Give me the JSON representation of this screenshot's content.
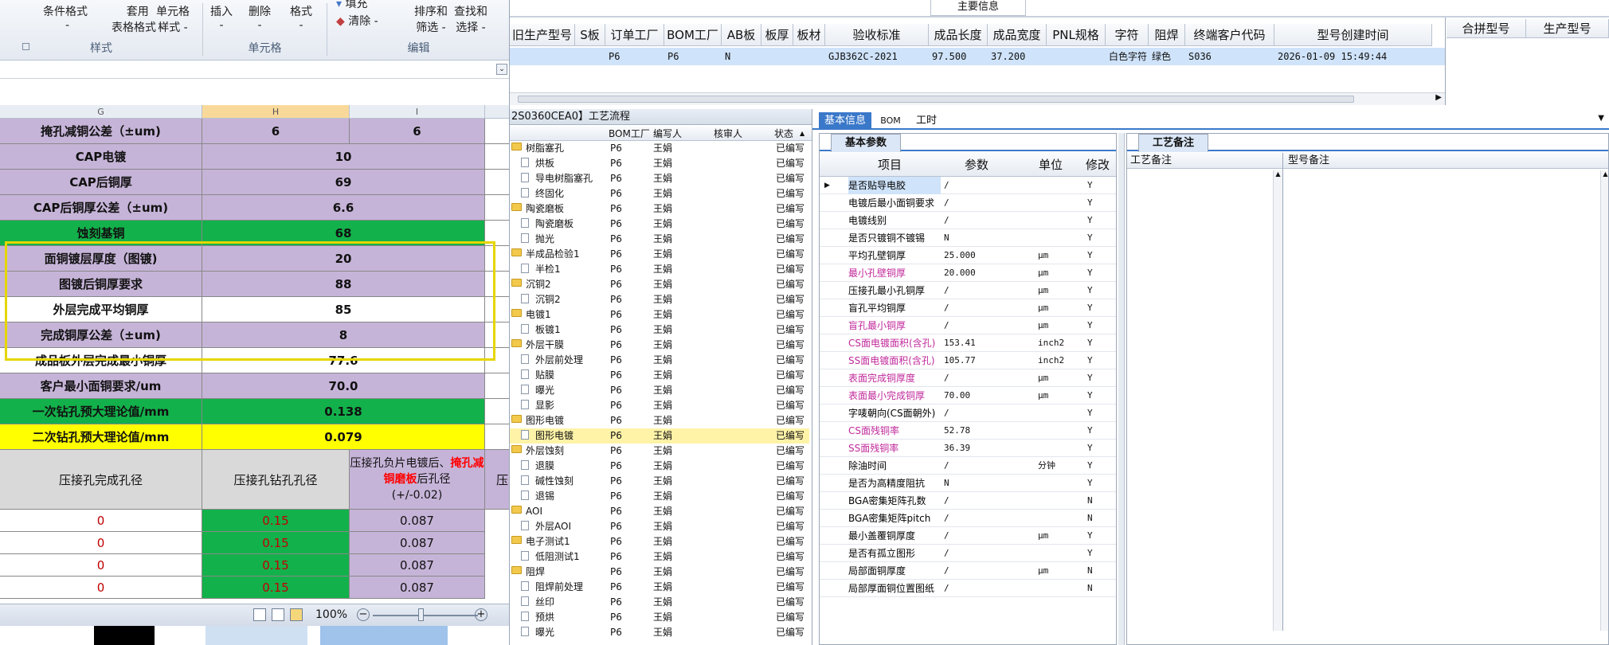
{
  "ribbon": {
    "buttons": [
      {
        "label": "条件格式",
        "sub": "-"
      },
      {
        "label": "套用",
        "sub": "表格格式 -"
      },
      {
        "label": "单元格",
        "sub": "样式 -"
      },
      {
        "label": "插入",
        "sub": "-"
      },
      {
        "label": "删除",
        "sub": "-"
      },
      {
        "label": "格式",
        "sub": "-"
      },
      {
        "label": "填充",
        "sub": ""
      },
      {
        "label": "清除 -",
        "sub": ""
      },
      {
        "label": "排序和",
        "sub": "筛选 -"
      },
      {
        "label": "查找和",
        "sub": "选择 -"
      }
    ],
    "groups": [
      "样式",
      "单元格",
      "编辑"
    ]
  },
  "sheet": {
    "columns": [
      "G",
      "H",
      "I"
    ],
    "rows": [
      {
        "label": "掩孔减铜公差（±um)",
        "h": "6",
        "i": "6",
        "fill": "pur"
      },
      {
        "label": "CAP电镀",
        "h": "10",
        "fill": "pur"
      },
      {
        "label": "CAP后铜厚",
        "h": "69",
        "fill": "pur"
      },
      {
        "label": "CAP后铜厚公差（±um)",
        "h": "6.6",
        "fill": "pur"
      },
      {
        "label": "蚀刻基铜",
        "h": "68",
        "fill": "grn"
      },
      {
        "label": "面铜镀层厚度（图镀)",
        "h": "20",
        "fill": "pur"
      },
      {
        "label": "图镀后铜厚要求",
        "h": "88",
        "fill": "pur"
      },
      {
        "label": "外层完成平均铜厚",
        "h": "85",
        "fill": "wht"
      },
      {
        "label": "完成铜厚公差（±um)",
        "h": "8",
        "fill": "pur"
      },
      {
        "label": "成品板外层完成最小铜厚",
        "h": "77.6",
        "fill": "wht"
      },
      {
        "label": "客户最小面铜要求/um",
        "h": "70.0",
        "fill": "pur"
      },
      {
        "label": "一次钻孔预大理论值/mm",
        "h": "0.138",
        "fill": "grn"
      },
      {
        "label": "二次钻孔预大理论值/mm",
        "h": "0.079",
        "fill": "yel"
      }
    ],
    "header2": {
      "g": "压接孔完成孔径",
      "h": "压接孔钻孔孔径",
      "i_pre": "压接孔负片电镀后、",
      "i_red": "掩孔减铜磨板",
      "i_post": "后孔径",
      "i_tol": "(+/-0.02)",
      "j": "压"
    },
    "lower_rows": [
      {
        "g": "0",
        "h": "0.15",
        "i": "0.087"
      },
      {
        "g": "0",
        "h": "0.15",
        "i": "0.087"
      },
      {
        "g": "0",
        "h": "0.15",
        "i": "0.087"
      },
      {
        "g": "0",
        "h": "0.15",
        "i": "0.087"
      }
    ],
    "zoom": "100%"
  },
  "topgrid": {
    "banner": "主要信息",
    "headers": [
      "旧生产型号",
      "S板",
      "订单工厂",
      "BOM工厂",
      "AB板",
      "板厚",
      "板材",
      "验收标准",
      "成品长度",
      "成品宽度",
      "PNL规格",
      "字符",
      "阻焊",
      "终端客户代码",
      "型号创建时间"
    ],
    "row": [
      "",
      "",
      "P6",
      "P6",
      "N",
      "",
      "",
      "GJB362C-2021",
      "97.500",
      "37.200",
      "",
      "白色字符",
      "绿色",
      "S036",
      "2026-01-09 15:49:44"
    ],
    "side_headers": [
      "合拼型号",
      "生产型号"
    ]
  },
  "process": {
    "title": "2S0360CEA0】工艺流程",
    "headers": [
      "BOM工厂",
      "编写人",
      "核审人",
      "状态"
    ],
    "rows": [
      {
        "name": "树脂塞孔",
        "folder": true,
        "f": "P6",
        "w": "王娟",
        "s": "已编写"
      },
      {
        "name": "烘板",
        "folder": false,
        "f": "P6",
        "w": "王娟",
        "s": "已编写"
      },
      {
        "name": "导电树脂塞孔",
        "folder": false,
        "f": "P6",
        "w": "王娟",
        "s": "已编写"
      },
      {
        "name": "终固化",
        "folder": false,
        "f": "P6",
        "w": "王娟",
        "s": "已编写"
      },
      {
        "name": "陶瓷磨板",
        "folder": true,
        "f": "P6",
        "w": "王娟",
        "s": "已编写"
      },
      {
        "name": "陶瓷磨板",
        "folder": false,
        "f": "P6",
        "w": "王娟",
        "s": "已编写"
      },
      {
        "name": "抛光",
        "folder": false,
        "f": "P6",
        "w": "王娟",
        "s": "已编写"
      },
      {
        "name": "半成品检验1",
        "folder": true,
        "f": "P6",
        "w": "王娟",
        "s": "已编写"
      },
      {
        "name": "半检1",
        "folder": false,
        "f": "P6",
        "w": "王娟",
        "s": "已编写"
      },
      {
        "name": "沉铜2",
        "folder": true,
        "f": "P6",
        "w": "王娟",
        "s": "已编写"
      },
      {
        "name": "沉铜2",
        "folder": false,
        "f": "P6",
        "w": "王娟",
        "s": "已编写"
      },
      {
        "name": "电镀1",
        "folder": true,
        "f": "P6",
        "w": "王娟",
        "s": "已编写"
      },
      {
        "name": "板镀1",
        "folder": false,
        "f": "P6",
        "w": "王娟",
        "s": "已编写"
      },
      {
        "name": "外层干膜",
        "folder": true,
        "f": "P6",
        "w": "王娟",
        "s": "已编写"
      },
      {
        "name": "外层前处理",
        "folder": false,
        "f": "P6",
        "w": "王娟",
        "s": "已编写"
      },
      {
        "name": "贴膜",
        "folder": false,
        "f": "P6",
        "w": "王娟",
        "s": "已编写"
      },
      {
        "name": "曝光",
        "folder": false,
        "f": "P6",
        "w": "王娟",
        "s": "已编写"
      },
      {
        "name": "显影",
        "folder": false,
        "f": "P6",
        "w": "王娟",
        "s": "已编写"
      },
      {
        "name": "图形电镀",
        "folder": true,
        "f": "P6",
        "w": "王娟",
        "s": "已编写"
      },
      {
        "name": "图形电镀",
        "folder": false,
        "f": "P6",
        "w": "王娟",
        "s": "已编写",
        "selected": true
      },
      {
        "name": "外层蚀刻",
        "folder": true,
        "f": "P6",
        "w": "王娟",
        "s": "已编写"
      },
      {
        "name": "退膜",
        "folder": false,
        "f": "P6",
        "w": "王娟",
        "s": "已编写"
      },
      {
        "name": "碱性蚀刻",
        "folder": false,
        "f": "P6",
        "w": "王娟",
        "s": "已编写"
      },
      {
        "name": "退锡",
        "folder": false,
        "f": "P6",
        "w": "王娟",
        "s": "已编写"
      },
      {
        "name": "AOI",
        "folder": true,
        "f": "P6",
        "w": "王娟",
        "s": "已编写"
      },
      {
        "name": "外层AOI",
        "folder": false,
        "f": "P6",
        "w": "王娟",
        "s": "已编写"
      },
      {
        "name": "电子测试1",
        "folder": true,
        "f": "P6",
        "w": "王娟",
        "s": "已编写"
      },
      {
        "name": "低阻测试1",
        "folder": false,
        "f": "P6",
        "w": "王娟",
        "s": "已编写"
      },
      {
        "name": "阻焊",
        "folder": true,
        "f": "P6",
        "w": "王娟",
        "s": "已编写"
      },
      {
        "name": "阻焊前处理",
        "folder": false,
        "f": "P6",
        "w": "王娟",
        "s": "已编写"
      },
      {
        "name": "丝印",
        "folder": false,
        "f": "P6",
        "w": "王娟",
        "s": "已编写"
      },
      {
        "name": "预烘",
        "folder": false,
        "f": "P6",
        "w": "王娟",
        "s": "已编写"
      },
      {
        "name": "曝光",
        "folder": false,
        "f": "P6",
        "w": "王娟",
        "s": "已编写"
      }
    ]
  },
  "detail_tabs": [
    "基本信息",
    "BOM",
    "工时"
  ],
  "params": {
    "tab": "基本参数",
    "headers": [
      "项目",
      "参数",
      "单位",
      "修改"
    ],
    "rows": [
      {
        "item": "是否贴导电胶",
        "val": "/",
        "unit": "",
        "mod": "Y",
        "color": "#000",
        "current": true
      },
      {
        "item": "电镀后最小面铜要求",
        "val": "/",
        "unit": "",
        "mod": "Y",
        "color": "#000"
      },
      {
        "item": "电镀线别",
        "val": "/",
        "unit": "",
        "mod": "Y",
        "color": "#000"
      },
      {
        "item": "是否只镀铜不镀锡",
        "val": "N",
        "unit": "",
        "mod": "Y",
        "color": "#000"
      },
      {
        "item": "平均孔壁铜厚",
        "val": "25.000",
        "unit": "μm",
        "mod": "Y",
        "color": "#000"
      },
      {
        "item": "最小孔壁铜厚",
        "val": "20.000",
        "unit": "μm",
        "mod": "Y",
        "color": "#c0299b"
      },
      {
        "item": "压接孔最小孔铜厚",
        "val": "/",
        "unit": "μm",
        "mod": "Y",
        "color": "#000"
      },
      {
        "item": "盲孔平均铜厚",
        "val": "/",
        "unit": "μm",
        "mod": "Y",
        "color": "#000"
      },
      {
        "item": "盲孔最小铜厚",
        "val": "/",
        "unit": "μm",
        "mod": "Y",
        "color": "#c0299b"
      },
      {
        "item": "CS面电镀面积(含孔)",
        "val": "153.41",
        "unit": "inch2",
        "mod": "Y",
        "color": "#c0299b"
      },
      {
        "item": "SS面电镀面积(含孔)",
        "val": "105.77",
        "unit": "inch2",
        "mod": "Y",
        "color": "#c0299b"
      },
      {
        "item": "表面完成铜厚度",
        "val": "/",
        "unit": "μm",
        "mod": "Y",
        "color": "#c0299b"
      },
      {
        "item": "表面最小完成铜厚",
        "val": "70.00",
        "unit": "μm",
        "mod": "Y",
        "color": "#c0299b"
      },
      {
        "item": "字唛朝向(CS面朝外)",
        "val": "/",
        "unit": "",
        "mod": "Y",
        "color": "#000"
      },
      {
        "item": "CS面残铜率",
        "val": "52.78",
        "unit": "",
        "mod": "Y",
        "color": "#c0299b"
      },
      {
        "item": "SS面残铜率",
        "val": "36.39",
        "unit": "",
        "mod": "Y",
        "color": "#c0299b"
      },
      {
        "item": "除油时间",
        "val": "/",
        "unit": "分钟",
        "mod": "Y",
        "color": "#000"
      },
      {
        "item": "是否为高精度阻抗",
        "val": "N",
        "unit": "",
        "mod": "Y",
        "color": "#000"
      },
      {
        "item": "BGA密集矩阵孔数",
        "val": "/",
        "unit": "",
        "mod": "N",
        "color": "#000"
      },
      {
        "item": "BGA密集矩阵pitch",
        "val": "/",
        "unit": "",
        "mod": "N",
        "color": "#000"
      },
      {
        "item": "最小盖覆铜厚度",
        "val": "/",
        "unit": "μm",
        "mod": "Y",
        "color": "#000"
      },
      {
        "item": "是否有孤立图形",
        "val": "/",
        "unit": "",
        "mod": "Y",
        "color": "#000"
      },
      {
        "item": "局部面铜厚度",
        "val": "/",
        "unit": "μm",
        "mod": "N",
        "color": "#000"
      },
      {
        "item": "局部厚面铜位置图纸",
        "val": "/",
        "unit": "",
        "mod": "N",
        "color": "#000"
      }
    ]
  },
  "notes": {
    "tab": "工艺备注",
    "col1": "工艺备注",
    "col2": "型号备注"
  },
  "colors": {
    "purple": "#c6b4d8",
    "green": "#13b14b",
    "yellow": "#ffff00",
    "highlight": "#e6d600",
    "selected_row": "#fff3a8",
    "magenta_text": "#c0299b",
    "red_text": "#ff0000"
  }
}
